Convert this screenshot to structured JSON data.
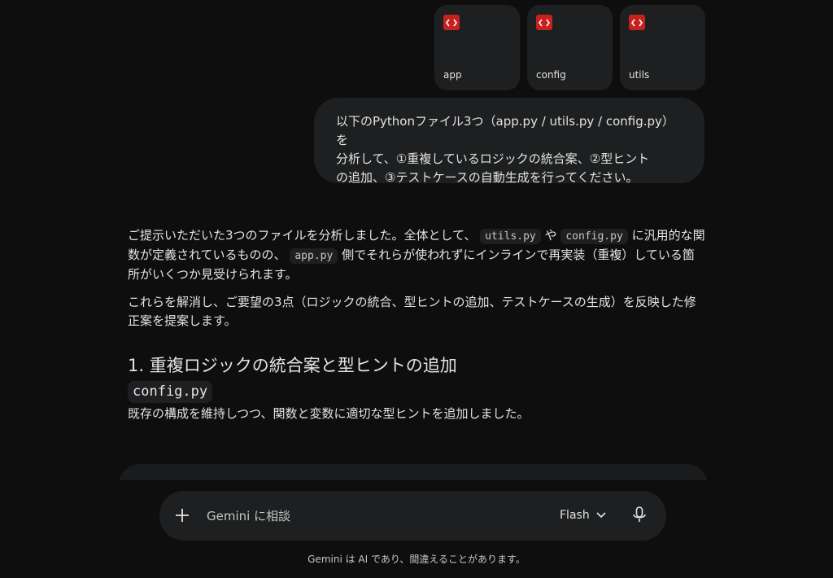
{
  "attachments": [
    {
      "name": "app"
    },
    {
      "name": "config"
    },
    {
      "name": "utils"
    }
  ],
  "user_message": {
    "line1": "以下のPythonファイル3つ（app.py / utils.py / config.py）を",
    "line2": "分析して、①重複しているロジックの統合案、②型ヒント",
    "line3": "の追加、③テストケースの自動生成を行ってください。"
  },
  "response": {
    "p1_part1": "ご提示いただいた3つのファイルを分析しました。全体として、",
    "p1_code1": "utils.py",
    "p1_part2": "や",
    "p1_code2": "config.py",
    "p1_part3": "に汎用的な関数が定義されているものの、",
    "p1_code3": "app.py",
    "p1_part4": "側でそれらが使われずにインラインで再実装（重複）している箇所がいくつか見受けられます。",
    "p2": "これらを解消し、ご要望の3点（ロジックの統合、型ヒントの追加、テストケースの生成）を反映した修正案を提案します。",
    "heading1": "1. 重複ロジックの統合案と型ヒントの追加",
    "code_heading": "config.py",
    "desc": "既存の構成を維持しつつ、関数と変数に適切な型ヒントを追加しました。"
  },
  "input": {
    "placeholder": "Gemini に相談",
    "model": "Flash"
  },
  "disclaimer": "Gemini は AI であり、間違えることがあります。",
  "colors": {
    "background": "#0e0e0f",
    "surface": "#1e1f20",
    "file_icon": "#c5221f",
    "text": "#e3e3e3"
  },
  "icons": {
    "file": "code-icon",
    "plus": "plus-icon",
    "dropdown": "chevron-down-icon",
    "mic": "mic-icon"
  }
}
